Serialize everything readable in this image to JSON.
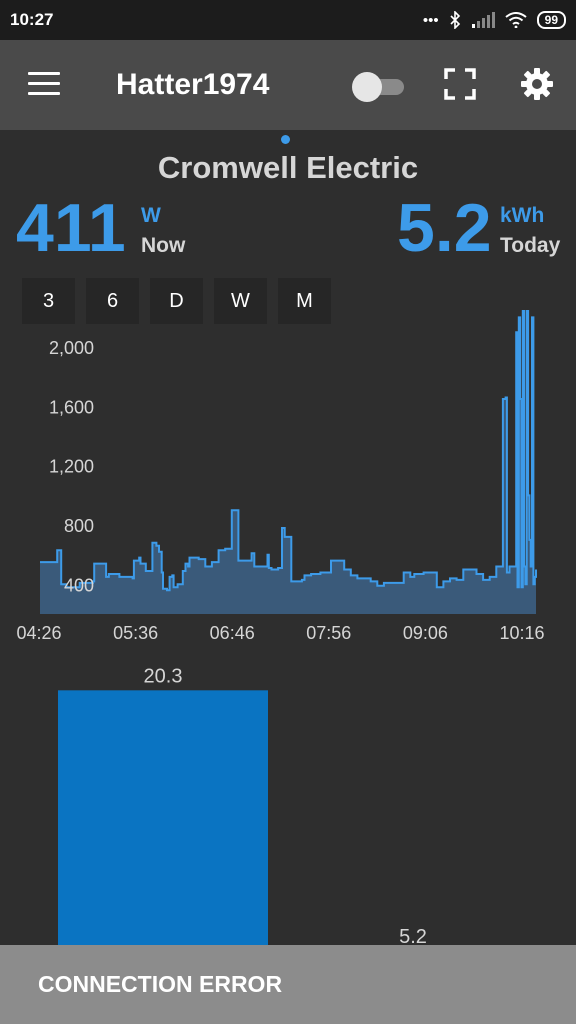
{
  "status_bar": {
    "time": "10:27",
    "battery": "99"
  },
  "app_bar": {
    "title": "Hatter1974",
    "toggle_on": false
  },
  "meter": {
    "name": "Cromwell Electric",
    "power_value": "411",
    "power_unit": "W",
    "power_label": "Now",
    "energy_value": "5.2",
    "energy_unit": "kWh",
    "energy_label": "Today"
  },
  "range_buttons": [
    "3",
    "6",
    "D",
    "W",
    "M"
  ],
  "colors": {
    "accent": "#3d9be9",
    "bar": "#0a74c2",
    "area_fill": "#3a5a7a"
  },
  "chart_data": [
    {
      "type": "area",
      "x_tick_labels": [
        "04:26",
        "05:36",
        "06:46",
        "07:56",
        "09:06",
        "10:16"
      ],
      "y_tick_labels": [
        "400",
        "800",
        "1,200",
        "1,600",
        "2,000"
      ],
      "y_ticks": [
        400,
        800,
        1200,
        1600,
        2000
      ],
      "ylim": [
        200,
        2250
      ],
      "xlim_minutes": [
        0,
        375
      ],
      "series": [
        {
          "x_minutes": [
            0,
            12,
            13,
            15,
            16,
            20,
            30,
            40,
            41,
            50,
            52,
            60,
            70,
            71,
            75,
            76,
            80,
            85,
            88,
            90,
            92,
            93,
            96,
            98,
            100,
            101,
            104,
            108,
            110,
            112,
            113,
            120,
            125,
            130,
            135,
            140,
            145,
            150,
            158,
            160,
            162,
            170,
            172,
            173,
            175,
            180,
            183,
            185,
            190,
            198,
            200,
            205,
            210,
            212,
            220,
            230,
            235,
            240,
            250,
            255,
            260,
            270,
            275,
            280,
            283,
            290,
            300,
            305,
            310,
            315,
            320,
            330,
            335,
            340,
            345,
            350,
            352,
            353,
            355,
            360,
            361,
            362,
            363,
            364,
            365,
            366,
            367,
            368,
            369,
            370,
            371,
            372,
            373,
            374,
            375
          ],
          "y_values": [
            550,
            550,
            630,
            630,
            400,
            380,
            410,
            420,
            540,
            450,
            470,
            450,
            440,
            560,
            580,
            540,
            490,
            680,
            660,
            620,
            480,
            370,
            360,
            450,
            460,
            380,
            400,
            490,
            540,
            520,
            580,
            570,
            520,
            550,
            630,
            640,
            900,
            560,
            560,
            610,
            520,
            520,
            600,
            510,
            500,
            510,
            780,
            720,
            420,
            430,
            460,
            470,
            470,
            480,
            560,
            500,
            460,
            440,
            420,
            390,
            410,
            410,
            480,
            450,
            470,
            480,
            380,
            420,
            440,
            430,
            500,
            470,
            430,
            450,
            520,
            1650,
            1660,
            480,
            520,
            2100,
            380,
            2200,
            1650,
            380,
            2250,
            520,
            400,
            2250,
            1000,
            700,
            520,
            2200,
            400,
            450,
            500
          ]
        }
      ]
    },
    {
      "type": "bar",
      "categories": [
        "",
        ""
      ],
      "values": [
        20.3,
        5.2
      ],
      "value_labels": [
        "20.3",
        "5.2"
      ],
      "ylim": [
        0,
        22
      ]
    }
  ],
  "connection_error": "CONNECTION ERROR"
}
